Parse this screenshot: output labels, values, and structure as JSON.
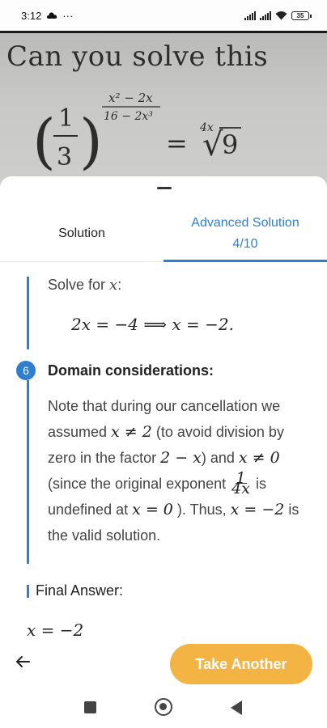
{
  "status_bar": {
    "time": "3:12",
    "dots": "···",
    "battery": "35"
  },
  "photo": {
    "heading": "Can you solve this",
    "equation": {
      "lparen": "(",
      "rparen": ")",
      "base_num": "1",
      "base_den": "3",
      "exp_num": "x² − 2x",
      "exp_den": "16 − 2x³",
      "equals": "=",
      "root_index": "4x",
      "root_symbol": "√",
      "radicand": "9"
    }
  },
  "tabs": {
    "solution": "Solution",
    "advanced_line1": "Advanced Solution",
    "advanced_line2": "4/10"
  },
  "steps": {
    "solve_for": "Solve for ",
    "solve_var": "x",
    "solve_colon": ":",
    "display_eq": "2x = −4   ⟹   x = −2.",
    "step_number": "6",
    "step_title": "Domain considerations:",
    "para": {
      "t1": "Note that during our cancellation we assumed ",
      "m1": "x ≠ 2",
      "t2": " (to avoid division by zero in the factor ",
      "m2": "2 − x",
      "t3": ") and ",
      "m3": "x ≠ 0",
      "t4": " (since the original exponent ",
      "frac_num": "1",
      "frac_den": "4x",
      "t5": " is undefined at ",
      "m4": "x = 0",
      "t6": " ). Thus, ",
      "m5": "x = −2",
      "t7": " is the valid solution."
    },
    "final_title": "Final Answer:",
    "final_eq": "x = −2"
  },
  "actions": {
    "take_another": "Take Another"
  },
  "colors": {
    "accent": "#2f7fd0",
    "cta": "#f4b444"
  },
  "icons": {
    "back": "arrow-left-icon",
    "cloud": "cloud-icon",
    "wifi": "wifi-icon",
    "signal": "signal-icon",
    "nav_recents": "square-icon",
    "nav_home": "circle-icon",
    "nav_back": "triangle-back-icon"
  }
}
